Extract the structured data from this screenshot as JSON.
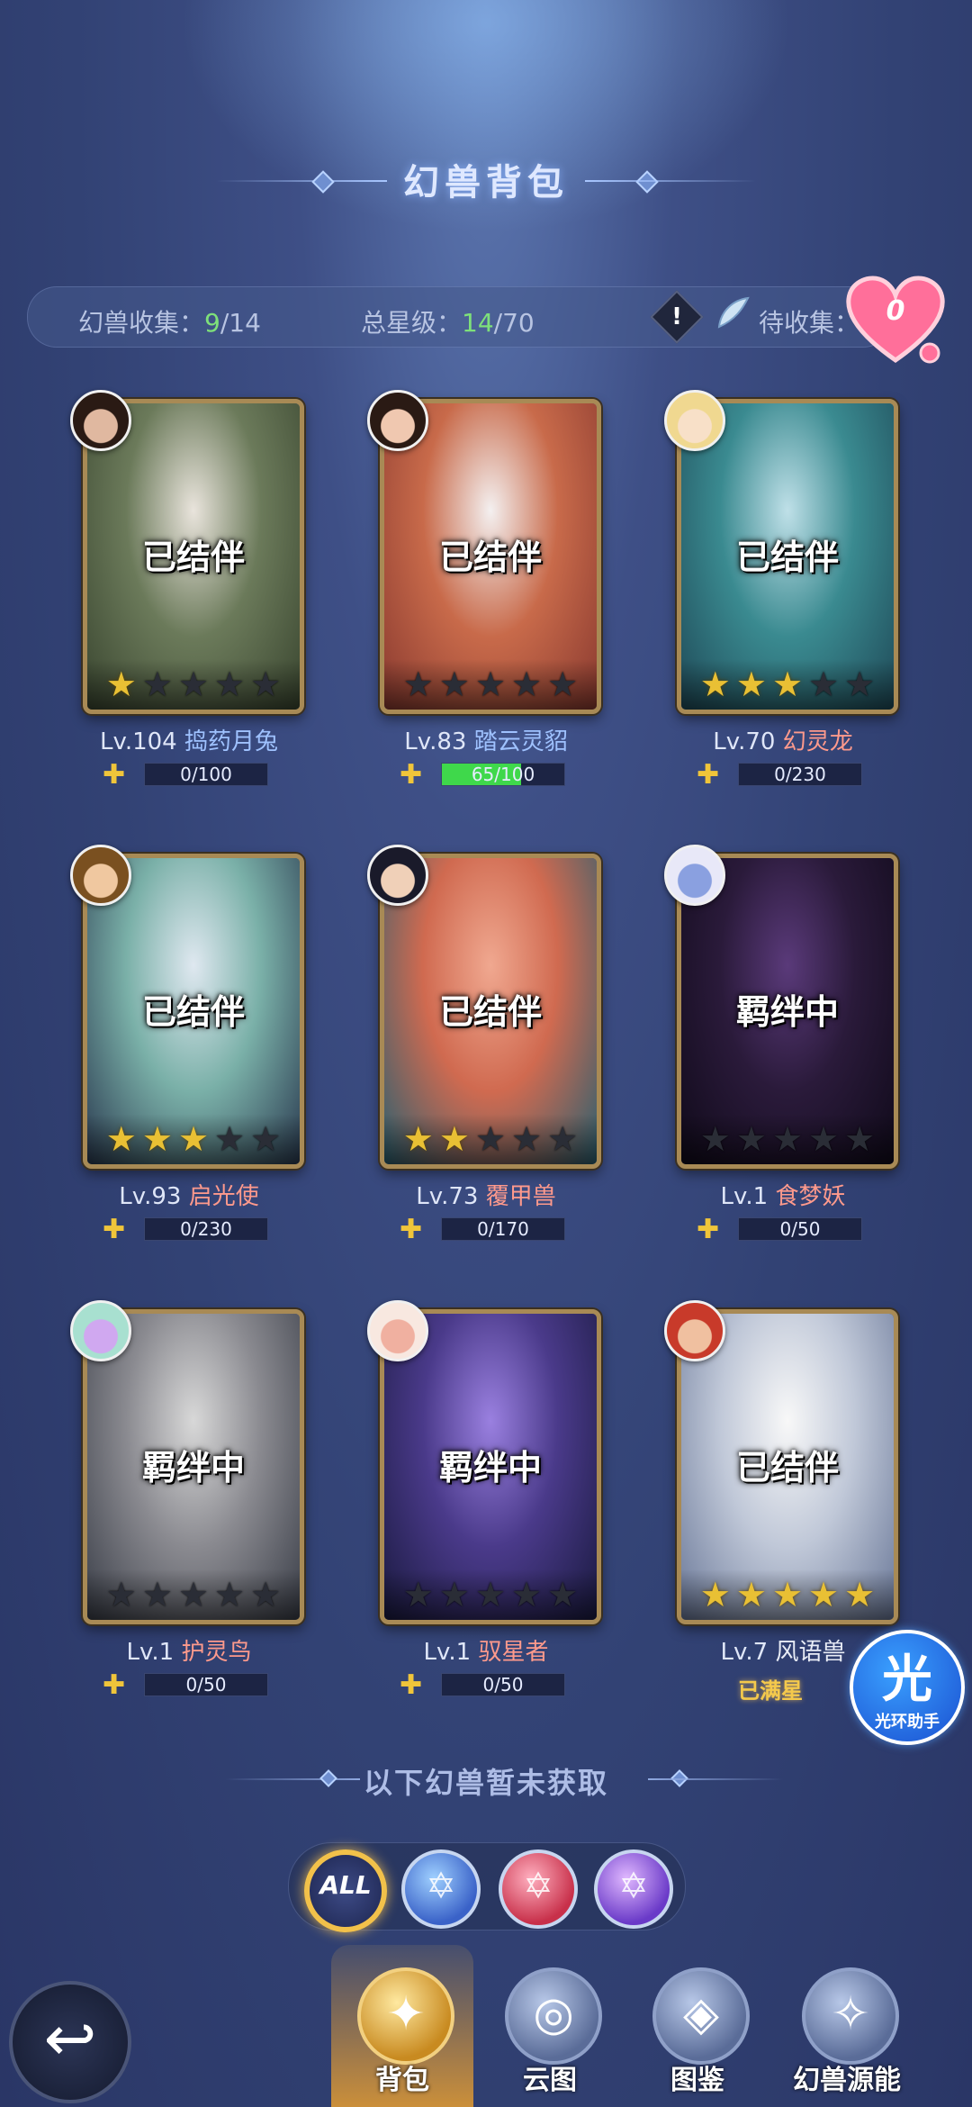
{
  "header": {
    "title": "幻兽背包"
  },
  "stats": {
    "collect_label": "幻兽收集：",
    "collect_have": "9",
    "collect_total": "/14",
    "stars_label": "总星级：",
    "stars_have": "14",
    "stars_total": "/70",
    "warn_symbol": "!",
    "pending_label": "待收集：",
    "heart_count": "0"
  },
  "cards": [
    {
      "status": "已结伴",
      "level": "Lv.104",
      "name": "捣药月兔",
      "name_color": "blue",
      "stars": 1,
      "progress": "0/100",
      "fill": 0.0,
      "art": [
        "#e9e4dc",
        "#6b7a5a",
        "#3a4630"
      ],
      "avatar": [
        "#2a1a14",
        "#e0b8a0"
      ]
    },
    {
      "status": "已结伴",
      "level": "Lv.83",
      "name": "踏云灵貂",
      "name_color": "blue",
      "stars": 0,
      "progress": "65/100",
      "fill": 0.65,
      "art": [
        "#f4f0f0",
        "#c86a4a",
        "#8a3a30"
      ],
      "avatar": [
        "#2a1a14",
        "#f0c8b0"
      ]
    },
    {
      "status": "已结伴",
      "level": "Lv.70",
      "name": "幻灵龙",
      "name_color": "red",
      "stars": 3,
      "progress": "0/230",
      "fill": 0.0,
      "art": [
        "#bfe0e8",
        "#3a8a90",
        "#1f4a58"
      ],
      "avatar": [
        "#f0d890",
        "#f8e0c8"
      ]
    },
    {
      "status": "已结伴",
      "level": "Lv.93",
      "name": "启光使",
      "name_color": "red",
      "stars": 3,
      "progress": "0/230",
      "fill": 0.0,
      "art": [
        "#dfe8f0",
        "#7ab0a8",
        "#2a3a50"
      ],
      "avatar": [
        "#7a5020",
        "#f0c8a0"
      ]
    },
    {
      "status": "已结伴",
      "level": "Lv.73",
      "name": "覆甲兽",
      "name_color": "red",
      "stars": 2,
      "progress": "0/170",
      "fill": 0.0,
      "art": [
        "#f0a890",
        "#d06a50",
        "#2a6070"
      ],
      "avatar": [
        "#1a1a2a",
        "#f0d0b8"
      ]
    },
    {
      "status": "羁绊中",
      "level": "Lv.1",
      "name": "食梦妖",
      "name_color": "red",
      "stars": 0,
      "progress": "0/50",
      "fill": 0.0,
      "art": [
        "#5a3a7a",
        "#2a1a3a",
        "#100a1a"
      ],
      "avatar": [
        "#e8e8f8",
        "#8aa0e0"
      ]
    },
    {
      "status": "羁绊中",
      "level": "Lv.1",
      "name": "护灵鸟",
      "name_color": "red",
      "stars": 0,
      "progress": "0/50",
      "fill": 0.0,
      "art": [
        "#d8d8d8",
        "#8a8a90",
        "#3a3e48"
      ],
      "avatar": [
        "#a8e0d0",
        "#d0a8f0"
      ]
    },
    {
      "status": "羁绊中",
      "level": "Lv.1",
      "name": "驭星者",
      "name_color": "red",
      "stars": 0,
      "progress": "0/50",
      "fill": 0.0,
      "art": [
        "#9a80e0",
        "#4a3a8a",
        "#1a1a40"
      ],
      "avatar": [
        "#f8e8e0",
        "#f0b0a0"
      ]
    },
    {
      "status": "已结伴",
      "level": "Lv.7",
      "name": "风语兽",
      "name_color": "white",
      "stars": 5,
      "progress": "已满星",
      "fill": 1.0,
      "maxed": true,
      "art": [
        "#f8f8f8",
        "#c0c8d8",
        "#6a7898"
      ],
      "avatar": [
        "#c83a2a",
        "#f0c0a0"
      ]
    }
  ],
  "helper": {
    "big": "光",
    "small": "光环助手"
  },
  "unacquired_title": "以下幻兽暂未获取",
  "filters": [
    {
      "label": "ALL",
      "kind": "all"
    },
    {
      "label": "",
      "kind": "blue"
    },
    {
      "label": "",
      "kind": "red"
    },
    {
      "label": "",
      "kind": "purple"
    }
  ],
  "nav": {
    "back_symbol": "↩",
    "items": [
      {
        "label": "背包",
        "icon": "✦",
        "active": true
      },
      {
        "label": "云图",
        "icon": "◎",
        "active": false
      },
      {
        "label": "图鉴",
        "icon": "◈",
        "active": false
      },
      {
        "label": "幻兽源能",
        "icon": "✧",
        "active": false
      }
    ]
  },
  "colors": {
    "accent_green": "#7ee07a",
    "gold": "#e9c034",
    "name_blue": "#9fc2ff",
    "name_red": "#ff9a8c"
  }
}
